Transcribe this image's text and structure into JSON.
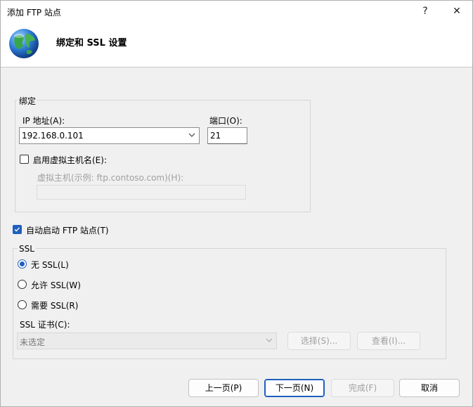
{
  "window": {
    "title": "添加 FTP 站点",
    "help_label": "?",
    "close_label": "✕"
  },
  "header": {
    "title": "绑定和 SSL 设置"
  },
  "binding": {
    "group_label": "绑定",
    "ip_label": "IP 地址(A):",
    "ip_value": "192.168.0.101",
    "port_label": "端口(O):",
    "port_value": "21",
    "virtual_host_label": "启用虚拟主机名(E):",
    "virtual_host_checked": false,
    "virtual_host_example_label": "虚拟主机(示例: ftp.contoso.com)(H):",
    "virtual_host_value": ""
  },
  "auto_start": {
    "label": "自动启动 FTP 站点(T)",
    "checked": true
  },
  "ssl": {
    "group_label": "SSL",
    "options": [
      {
        "label": "无 SSL(L)",
        "selected": true
      },
      {
        "label": "允许 SSL(W)",
        "selected": false
      },
      {
        "label": "需要 SSL(R)",
        "selected": false
      }
    ],
    "cert_label": "SSL 证书(C):",
    "cert_value": "未选定",
    "select_button": "选择(S)...",
    "view_button": "查看(I)..."
  },
  "footer": {
    "prev_button": "上一页(P)",
    "next_button": "下一页(N)",
    "finish_button": "完成(F)",
    "cancel_button": "取消"
  },
  "colors": {
    "accent": "#1f5fbf",
    "window_bg": "#f0f0f0"
  }
}
